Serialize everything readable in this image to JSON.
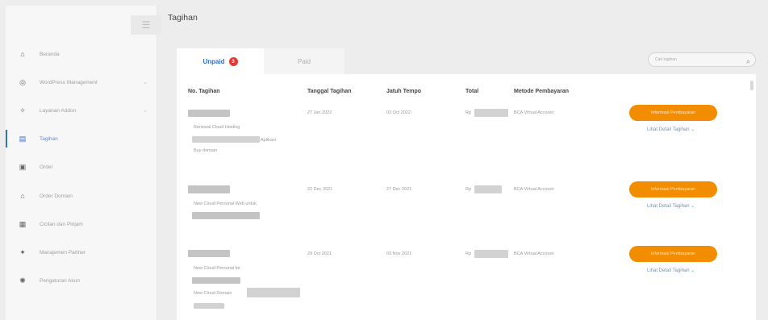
{
  "app": {
    "page_title": "Tagihan"
  },
  "sidebar": {
    "items": [
      {
        "label": "Beranda",
        "icon": "home-icon",
        "glyph": "⌂",
        "has_chevron": false,
        "active": false
      },
      {
        "label": "WordPress Management",
        "icon": "wordpress-icon",
        "glyph": "◎",
        "has_chevron": true,
        "active": false
      },
      {
        "label": "Layanan Addon",
        "icon": "addon-icon",
        "glyph": "✧",
        "has_chevron": true,
        "active": false
      },
      {
        "label": "Tagihan",
        "icon": "invoice-icon",
        "glyph": "▤",
        "has_chevron": false,
        "active": true
      },
      {
        "label": "Order",
        "icon": "briefcase-icon",
        "glyph": "▣",
        "has_chevron": false,
        "active": false
      },
      {
        "label": "Order Domain",
        "icon": "domain-icon",
        "glyph": "⌂",
        "has_chevron": false,
        "active": false
      },
      {
        "label": "Cicilan dan Pinjam",
        "icon": "wallet-icon",
        "glyph": "▦",
        "has_chevron": false,
        "active": false
      },
      {
        "label": "Manajemen Partner",
        "icon": "partner-icon",
        "glyph": "✦",
        "has_chevron": false,
        "active": false
      },
      {
        "label": "Pengaturan Akun",
        "icon": "gear-icon",
        "glyph": "✺",
        "has_chevron": false,
        "active": false
      }
    ]
  },
  "tabs": {
    "unpaid_label": "Unpaid",
    "unpaid_count": "3",
    "paid_label": "Paid"
  },
  "search": {
    "placeholder": "Cari tagihan"
  },
  "table": {
    "headers": {
      "no": "No. Tagihan",
      "date": "Tanggal Tagihan",
      "due": "Jatuh Tempo",
      "total": "Total",
      "method": "Metode Pembayaran"
    },
    "currency_prefix": "Rp",
    "rows": [
      {
        "date": "27 Jan 2022",
        "due": "03 Oct 2022",
        "method": "BCA Virtual Account",
        "desc_lines": [
          "Renewal Cloud Hosting",
          "Aplikasi",
          "Buy domain"
        ]
      },
      {
        "date": "22 Dec 2021",
        "due": "27 Dec 2021",
        "method": "BCA Virtual Account",
        "desc_lines": [
          "New Cloud Personal Web untuk"
        ]
      },
      {
        "date": "29 Oct 2021",
        "due": "03 Nov 2021",
        "method": "BCA Virtual Account",
        "desc_lines": [
          "New Cloud Personal for",
          "New Cloud Domain"
        ]
      }
    ],
    "pay_button_label": "Informasi Pembayaran",
    "detail_link_label": "Lihat Detail Tagihan ⌄"
  }
}
